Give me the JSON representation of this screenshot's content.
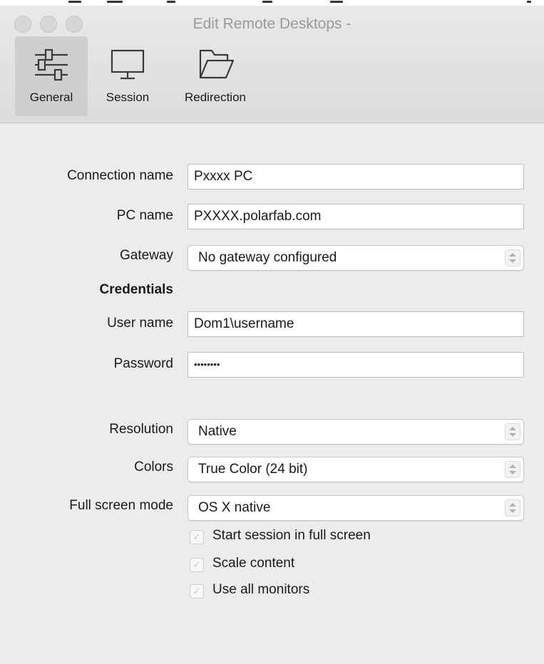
{
  "window": {
    "title": "Edit Remote Desktops -"
  },
  "toolbar": {
    "tabs": [
      {
        "label": "General",
        "icon": "sliders-icon",
        "active": true
      },
      {
        "label": "Session",
        "icon": "monitor-icon",
        "active": false
      },
      {
        "label": "Redirection",
        "icon": "folder-icon",
        "active": false
      }
    ]
  },
  "form": {
    "connection_name": {
      "label": "Connection name",
      "value": "Pxxxx PC"
    },
    "pc_name": {
      "label": "PC name",
      "value": "PXXXX.polarfab.com"
    },
    "gateway": {
      "label": "Gateway",
      "value": "No gateway configured"
    },
    "credentials_heading": "Credentials",
    "user_name": {
      "label": "User name",
      "value": "Dom1\\username"
    },
    "password": {
      "label": "Password",
      "value": "••••••••"
    },
    "resolution": {
      "label": "Resolution",
      "value": "Native"
    },
    "colors": {
      "label": "Colors",
      "value": "True Color (24 bit)"
    },
    "full_screen_mode": {
      "label": "Full screen mode",
      "value": "OS X native"
    },
    "checkboxes": [
      {
        "label": "Start session in full screen",
        "checked": true
      },
      {
        "label": "Scale content",
        "checked": true
      },
      {
        "label": "Use all monitors",
        "checked": true
      }
    ]
  }
}
